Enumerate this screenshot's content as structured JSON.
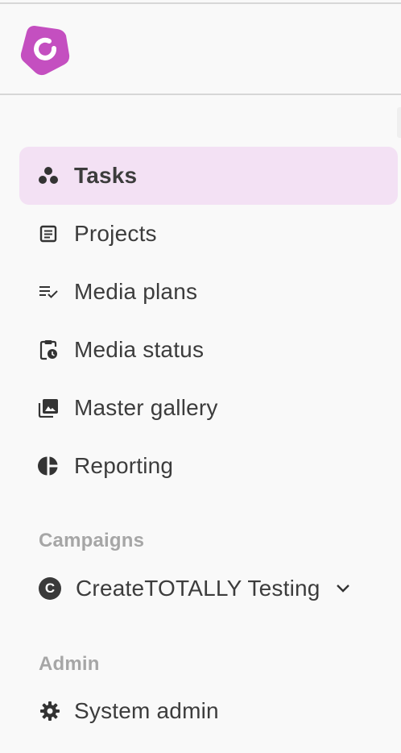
{
  "brand": {
    "accent": "#c44fc0",
    "logo_icon": "createtotally-logo-icon"
  },
  "nav": {
    "items": [
      {
        "label": "Tasks",
        "icon": "tasks-icon",
        "active": true
      },
      {
        "label": "Projects",
        "icon": "projects-icon",
        "active": false
      },
      {
        "label": "Media plans",
        "icon": "media-plans-icon",
        "active": false
      },
      {
        "label": "Media status",
        "icon": "media-status-icon",
        "active": false
      },
      {
        "label": "Master gallery",
        "icon": "gallery-icon",
        "active": false
      },
      {
        "label": "Reporting",
        "icon": "reporting-icon",
        "active": false
      }
    ]
  },
  "campaigns": {
    "title": "Campaigns",
    "selected": {
      "badge": "C",
      "label": "CreateTOTALLY Testing",
      "icon": "chevron-down-icon"
    }
  },
  "admin": {
    "title": "Admin",
    "item": {
      "label": "System admin",
      "icon": "gear-icon"
    }
  },
  "colors": {
    "active_bg": "#f3e1f4",
    "section_title": "#a6a6a6",
    "text": "#3c3c3c"
  }
}
